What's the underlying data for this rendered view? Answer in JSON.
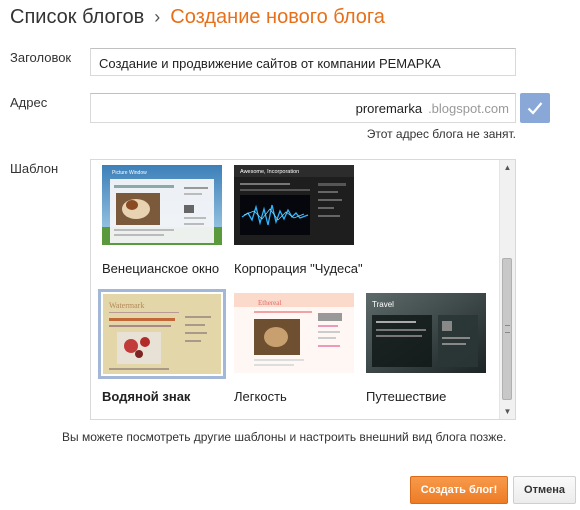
{
  "breadcrumb": {
    "parent": "Список блогов",
    "separator": "›",
    "current": "Создание нового блога"
  },
  "form": {
    "title_label": "Заголовок",
    "title_value": "Создание и продвижение сайтов от компании РЕМАРКА",
    "address_label": "Адрес",
    "address_value": "proremarka",
    "address_suffix": ".blogspot.com",
    "address_status": "Этот адрес блога не занят.",
    "template_label": "Шаблон"
  },
  "templates": [
    {
      "name": "Венецианское окно",
      "selected": false,
      "bold": false,
      "thumb_text": "Picture Window"
    },
    {
      "name": "Корпорация \"Чудеса\"",
      "selected": false,
      "bold": false,
      "thumb_text": "Awesome, Incorporation"
    },
    {
      "name": "Водяной знак",
      "selected": true,
      "bold": true,
      "thumb_text": "Watermark"
    },
    {
      "name": "Легкость",
      "selected": false,
      "bold": false,
      "thumb_text": "Ethereal"
    },
    {
      "name": "Путешествие",
      "selected": false,
      "bold": false,
      "thumb_text": "Travel"
    }
  ],
  "hint": "Вы можете посмотреть другие шаблоны и настроить внешний вид блога позже.",
  "buttons": {
    "create": "Создать блог!",
    "cancel": "Отмена"
  },
  "colors": {
    "accent": "#e8701a",
    "button": "#f08a34",
    "check": "#8aa8d7",
    "selected_border": "#a3b8d8"
  }
}
